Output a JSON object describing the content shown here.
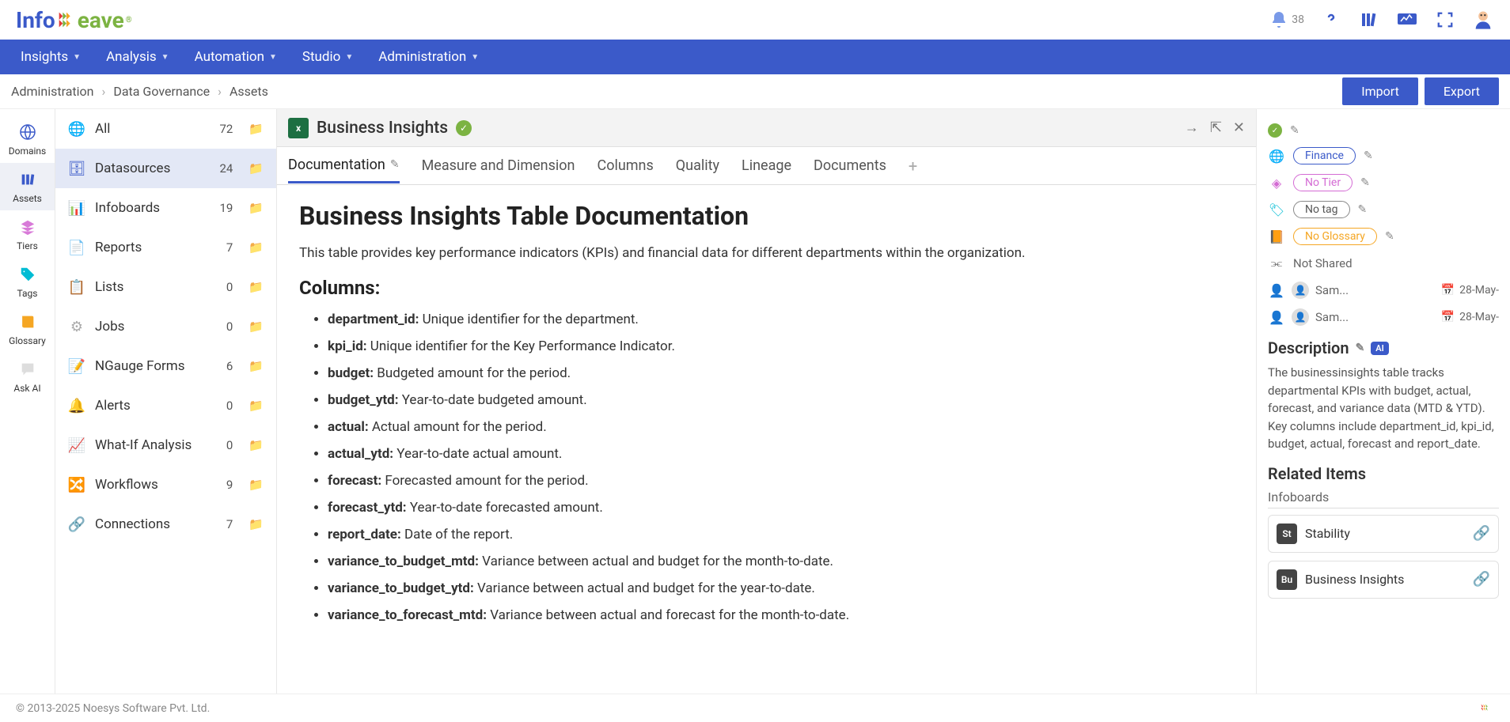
{
  "logo": {
    "part1": "Info",
    "part2": "eave"
  },
  "top": {
    "bell_count": "38"
  },
  "nav": {
    "items": [
      "Insights",
      "Analysis",
      "Automation",
      "Studio",
      "Administration"
    ]
  },
  "breadcrumb": {
    "items": [
      "Administration",
      "Data Governance",
      "Assets"
    ]
  },
  "actions": {
    "import": "Import",
    "export": "Export"
  },
  "rail": {
    "items": [
      {
        "label": "Domains",
        "color": "#3b5ac9"
      },
      {
        "label": "Assets",
        "color": "#3b5ac9"
      },
      {
        "label": "Tiers",
        "color": "#d46bd4"
      },
      {
        "label": "Tags",
        "color": "#00bcd4"
      },
      {
        "label": "Glossary",
        "color": "#f5a623"
      },
      {
        "label": "Ask AI",
        "color": "#ccc"
      }
    ]
  },
  "sidebar": {
    "items": [
      {
        "label": "All",
        "count": "72"
      },
      {
        "label": "Datasources",
        "count": "24"
      },
      {
        "label": "Infoboards",
        "count": "19"
      },
      {
        "label": "Reports",
        "count": "7"
      },
      {
        "label": "Lists",
        "count": "0"
      },
      {
        "label": "Jobs",
        "count": "0"
      },
      {
        "label": "NGauge Forms",
        "count": "6"
      },
      {
        "label": "Alerts",
        "count": "0"
      },
      {
        "label": "What-If Analysis",
        "count": "0"
      },
      {
        "label": "Workflows",
        "count": "9"
      },
      {
        "label": "Connections",
        "count": "7"
      }
    ]
  },
  "doc": {
    "title": "Business Insights",
    "tabs": [
      "Documentation",
      "Measure and Dimension",
      "Columns",
      "Quality",
      "Lineage",
      "Documents"
    ],
    "h1": "Business Insights Table Documentation",
    "intro": "This table provides key performance indicators (KPIs) and financial data for different departments within the organization.",
    "h2": "Columns:",
    "columns": [
      {
        "name": "department_id:",
        "desc": " Unique identifier for the department."
      },
      {
        "name": "kpi_id:",
        "desc": " Unique identifier for the Key Performance Indicator."
      },
      {
        "name": "budget:",
        "desc": " Budgeted amount for the period."
      },
      {
        "name": "budget_ytd:",
        "desc": " Year-to-date budgeted amount."
      },
      {
        "name": "actual:",
        "desc": " Actual amount for the period."
      },
      {
        "name": "actual_ytd:",
        "desc": " Year-to-date actual amount."
      },
      {
        "name": "forecast:",
        "desc": " Forecasted amount for the period."
      },
      {
        "name": "forecast_ytd:",
        "desc": " Year-to-date forecasted amount."
      },
      {
        "name": "report_date:",
        "desc": " Date of the report."
      },
      {
        "name": "variance_to_budget_mtd:",
        "desc": " Variance between actual and budget for the month-to-date."
      },
      {
        "name": "variance_to_budget_ytd:",
        "desc": " Variance between actual and budget for the year-to-date."
      },
      {
        "name": "variance_to_forecast_mtd:",
        "desc": " Variance between actual and forecast for the month-to-date."
      }
    ]
  },
  "side": {
    "finance": "Finance",
    "tier": "No Tier",
    "tag": "No tag",
    "glossary": "No Glossary",
    "shared": "Not Shared",
    "user1": "Sam...",
    "user2": "Sam...",
    "date1": "28-May-",
    "date2": "28-May-",
    "desc_h": "Description",
    "ai": "AI",
    "desc": "The businessinsights table tracks departmental KPIs with budget, actual, forecast, and variance data (MTD & YTD). Key columns include department_id, kpi_id, budget, actual, forecast and report_date.",
    "related_h": "Related Items",
    "infoboards_h": "Infoboards",
    "related": [
      {
        "badge": "St",
        "label": "Stability"
      },
      {
        "badge": "Bu",
        "label": "Business Insights"
      }
    ]
  },
  "footer": {
    "copy": "© 2013-2025 Noesys Software Pvt. Ltd."
  }
}
